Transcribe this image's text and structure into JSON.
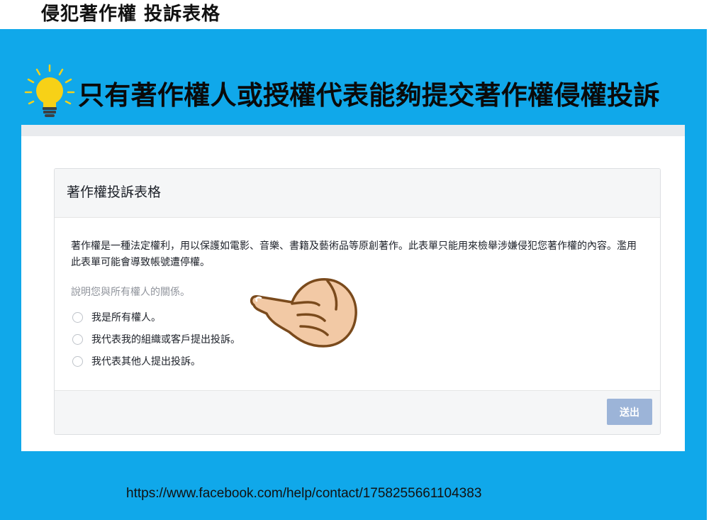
{
  "page_title": "侵犯著作權 投訴表格",
  "banner": {
    "icon": "lightbulb-icon",
    "text": "只有著作權人或授權代表能夠提交著作權侵權投訴"
  },
  "form": {
    "title": "著作權投訴表格",
    "intro": "著作權是一種法定權利，用以保護如電影、音樂、書籍及藝術品等原創著作。此表單只能用來檢舉涉嫌侵犯您著作權的內容。濫用此表單可能會導致帳號遭停權。",
    "question": "說明您與所有權人的關係。",
    "options": [
      {
        "label": "我是所有權人。",
        "selected": false
      },
      {
        "label": "我代表我的組織或客戶提出投訴。",
        "selected": false
      },
      {
        "label": "我代表其他人提出投訴。",
        "selected": false
      }
    ],
    "submit_label": "送出"
  },
  "pointer": "pointing-hand-icon",
  "url": "https://www.facebook.com/help/contact/1758255661104383",
  "colors": {
    "panel_background": "#10a8ea",
    "submit_button": "#9cb4d8",
    "card_header": "#f5f6f7"
  }
}
